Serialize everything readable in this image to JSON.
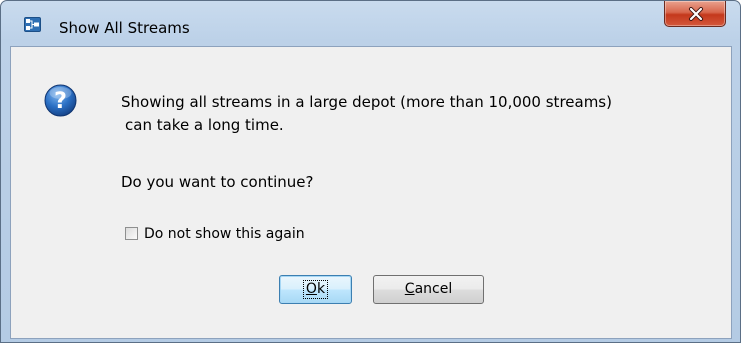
{
  "window": {
    "title": "Show All Streams",
    "app_icon": "streams-graph-icon",
    "close_icon": "close-icon"
  },
  "dialog": {
    "icon": "question-icon",
    "message_line1": "Showing all streams in a large depot (more than 10,000 streams)",
    "message_line2": "can take a long time.",
    "question": "Do you want to continue?",
    "checkbox": {
      "label": "Do not show this again",
      "checked": false
    },
    "buttons": {
      "ok_mnemonic": "O",
      "ok_rest": "k",
      "cancel_mnemonic": "C",
      "cancel_rest": "ancel"
    }
  },
  "colors": {
    "frame": "#b4cbe4",
    "client_bg": "#f0f0f0",
    "close_red": "#c4381c",
    "question_blue": "#1d5fb0"
  }
}
